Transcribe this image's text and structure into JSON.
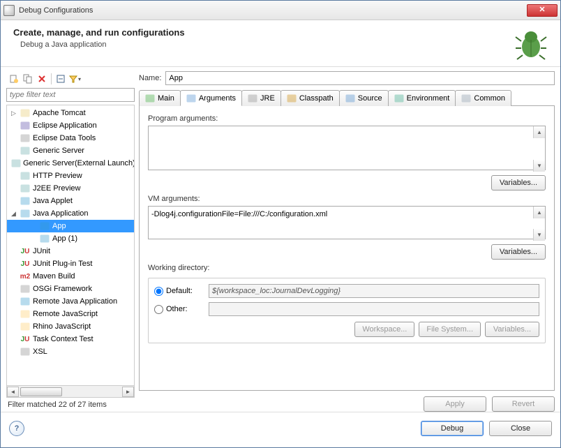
{
  "window": {
    "title": "Debug Configurations"
  },
  "header": {
    "title": "Create, manage, and run configurations",
    "subtitle": "Debug a Java application"
  },
  "filter": {
    "placeholder": "type filter text"
  },
  "tree": {
    "items": [
      {
        "label": "Apache Tomcat",
        "icon": "tomcat"
      },
      {
        "label": "Eclipse Application",
        "icon": "eclipse"
      },
      {
        "label": "Eclipse Data Tools",
        "icon": "db"
      },
      {
        "label": "Generic Server",
        "icon": "server"
      },
      {
        "label": "Generic Server(External Launch)",
        "icon": "server"
      },
      {
        "label": "HTTP Preview",
        "icon": "server"
      },
      {
        "label": "J2EE Preview",
        "icon": "server"
      },
      {
        "label": "Java Applet",
        "icon": "applet"
      },
      {
        "label": "Java Application",
        "icon": "java-app",
        "expanded": true,
        "children": [
          {
            "label": "App",
            "icon": "java-run",
            "selected": true
          },
          {
            "label": "App (1)",
            "icon": "java-run"
          }
        ]
      },
      {
        "label": "JUnit",
        "icon": "junit"
      },
      {
        "label": "JUnit Plug-in Test",
        "icon": "junit-plugin"
      },
      {
        "label": "Maven Build",
        "icon": "maven"
      },
      {
        "label": "OSGi Framework",
        "icon": "osgi"
      },
      {
        "label": "Remote Java Application",
        "icon": "remote-java"
      },
      {
        "label": "Remote JavaScript",
        "icon": "remote-js"
      },
      {
        "label": "Rhino JavaScript",
        "icon": "rhino"
      },
      {
        "label": "Task Context Test",
        "icon": "task"
      },
      {
        "label": "XSL",
        "icon": "xsl"
      }
    ]
  },
  "filter_status": "Filter matched 22 of 27 items",
  "name": {
    "label": "Name:",
    "value": "App"
  },
  "tabs": {
    "items": [
      {
        "label": "Main",
        "icon": "main"
      },
      {
        "label": "Arguments",
        "icon": "args",
        "active": true
      },
      {
        "label": "JRE",
        "icon": "jre"
      },
      {
        "label": "Classpath",
        "icon": "classpath"
      },
      {
        "label": "Source",
        "icon": "source"
      },
      {
        "label": "Environment",
        "icon": "env"
      },
      {
        "label": "Common",
        "icon": "common"
      }
    ]
  },
  "args": {
    "program_label": "Program arguments:",
    "program_value": "",
    "variables_btn": "Variables...",
    "vm_label": "VM arguments:",
    "vm_value": "-Dlog4j.configurationFile=File:///C:/configuration.xml"
  },
  "wd": {
    "legend": "Working directory:",
    "default_label": "Default:",
    "default_value": "${workspace_loc:JournalDevLogging}",
    "other_label": "Other:",
    "workspace_btn": "Workspace...",
    "filesystem_btn": "File System...",
    "variables_btn": "Variables..."
  },
  "buttons": {
    "apply": "Apply",
    "revert": "Revert",
    "debug": "Debug",
    "close": "Close"
  }
}
